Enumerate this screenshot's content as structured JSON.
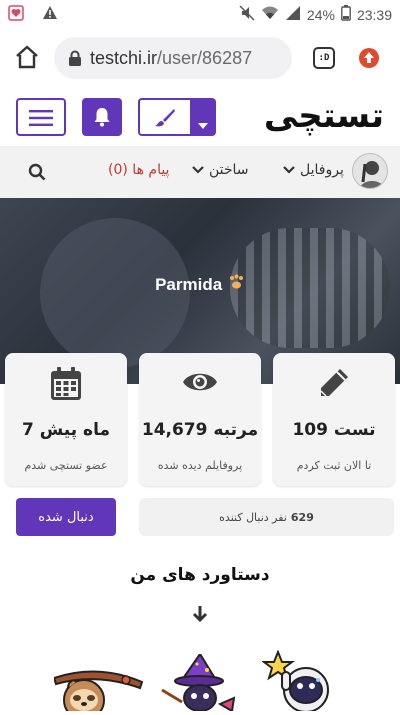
{
  "statusbar": {
    "battery": "24%",
    "time": "23:39"
  },
  "browser": {
    "url_domain": "testchi.ir",
    "url_path": "/user/86287",
    "tab_icon_label": ":D"
  },
  "header": {
    "logo_text": "تستچی"
  },
  "nav": {
    "profile_label": "پروفایل",
    "build_label": "ساختن",
    "messages_label": "پیام ها (0)"
  },
  "hero": {
    "username": "Parmida"
  },
  "stats": [
    {
      "icon": "pencil-icon",
      "value": "109 تست",
      "caption": "تا الان ثبت کردم"
    },
    {
      "icon": "eye-icon",
      "value": "14,679 مرتبه",
      "caption": "پروفایلم دیده شده"
    },
    {
      "icon": "calendar-icon",
      "value": "7 ماه پیش",
      "caption": "عضو تستچی شدم"
    }
  ],
  "follow": {
    "button_label": "دنبال شده",
    "followers_count": "629",
    "followers_text": "نفر دنبال کننده"
  },
  "achievements": {
    "title": "دستاورد های من"
  },
  "colors": {
    "primary": "#6236b8",
    "accent_red": "#c0392b"
  }
}
